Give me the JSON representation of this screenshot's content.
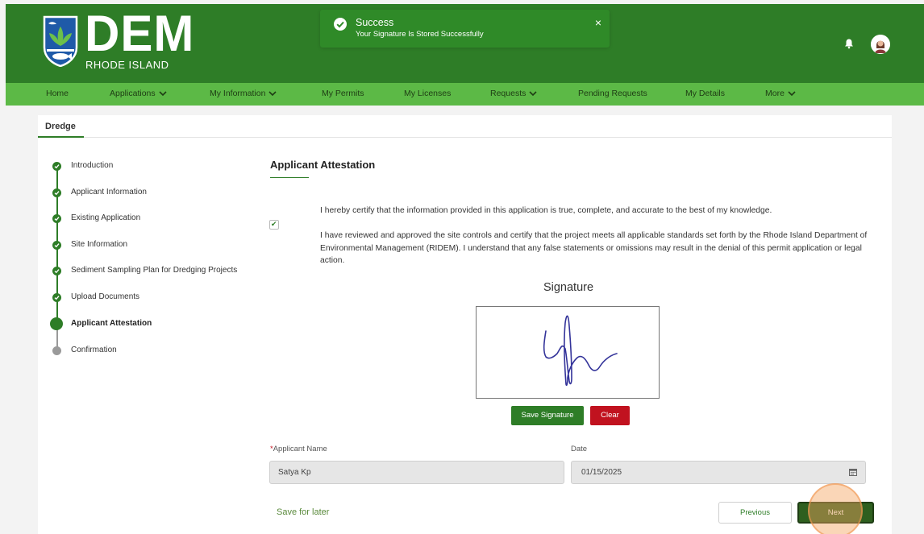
{
  "brand": {
    "logo_name": "DEM",
    "logo_subtitle": "RHODE ISLAND",
    "primary_color": "#2e7d27",
    "nav_color": "#5cb946",
    "danger_color": "#c1121f"
  },
  "toast": {
    "title": "Success",
    "message": "Your Signature Is Stored Successfully",
    "close_glyph": "×"
  },
  "nav": {
    "items": [
      {
        "label": "Home",
        "dropdown": false
      },
      {
        "label": "Applications",
        "dropdown": true
      },
      {
        "label": "My Information",
        "dropdown": true
      },
      {
        "label": "My Permits",
        "dropdown": false
      },
      {
        "label": "My Licenses",
        "dropdown": false
      },
      {
        "label": "Requests",
        "dropdown": true
      },
      {
        "label": "Pending Requests",
        "dropdown": false
      },
      {
        "label": "My Details",
        "dropdown": false
      },
      {
        "label": "More",
        "dropdown": true
      }
    ]
  },
  "tab": {
    "label": "Dredge"
  },
  "steps": [
    {
      "label": "Introduction",
      "status": "complete"
    },
    {
      "label": "Applicant Information",
      "status": "complete"
    },
    {
      "label": "Existing Application",
      "status": "complete"
    },
    {
      "label": "Site Information",
      "status": "complete"
    },
    {
      "label": "Sediment Sampling Plan for Dredging Projects",
      "status": "complete"
    },
    {
      "label": "Upload Documents",
      "status": "complete"
    },
    {
      "label": "Applicant Attestation",
      "status": "active"
    },
    {
      "label": "Confirmation",
      "status": "pending"
    }
  ],
  "attestation": {
    "title": "Applicant Attestation",
    "statement_1": "I hereby certify that the information provided in this application is true, complete, and accurate to the best of my knowledge.",
    "statement_2": "I have reviewed and approved the site controls and certify that the project meets all applicable standards set forth by the Rhode Island Department of Environmental Management (RIDEM). I understand that any false statements or omissions may result in the denial of this permit application or legal action.",
    "checked": true,
    "check_glyph": "✔"
  },
  "signature": {
    "title": "Signature",
    "save_label": "Save Signature",
    "clear_label": "Clear"
  },
  "form": {
    "name_label": "Applicant Name",
    "name_required": "*",
    "name_value": "Satya Kp",
    "date_label": "Date",
    "date_value": "01/15/2025"
  },
  "footer": {
    "save_later": "Save for later",
    "previous": "Previous",
    "next": "Next"
  }
}
